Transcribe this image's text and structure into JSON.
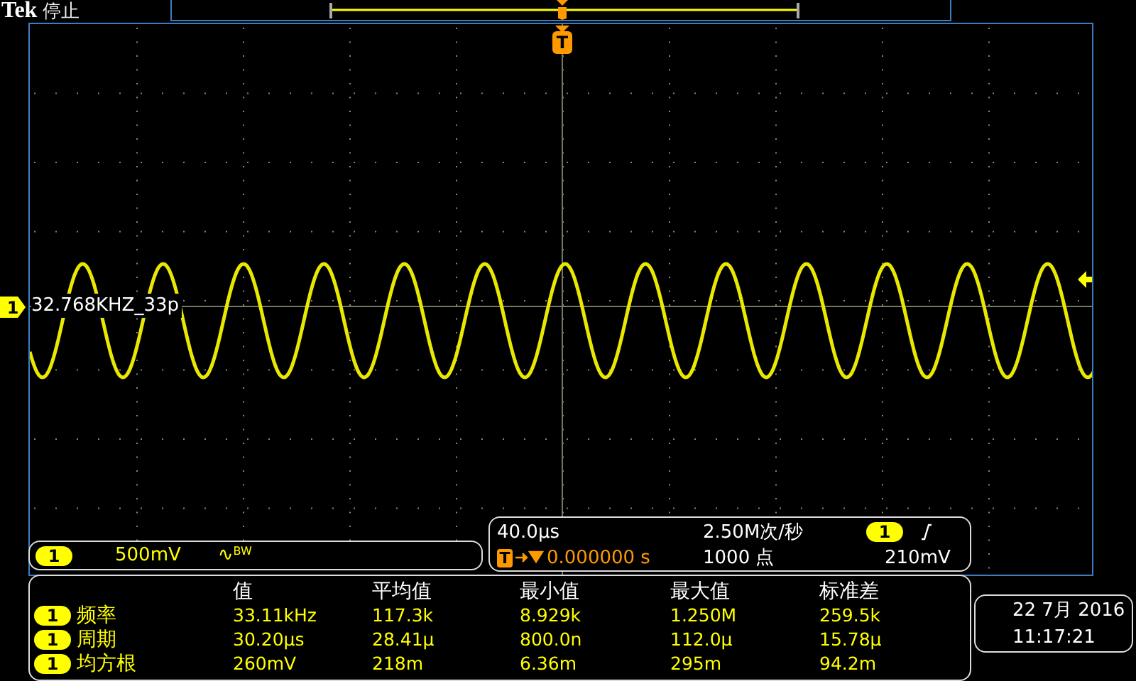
{
  "status": {
    "brand": "Tek",
    "state": "停止"
  },
  "trigger_marker": {
    "label": "T"
  },
  "channel": {
    "number": "1",
    "panel_number": "1",
    "label": "32.768KHZ_33p",
    "scale": "500mV",
    "bandwidth_symbol": "∿",
    "bandwidth_label": "BW"
  },
  "horizontal": {
    "scale": "40.0µs",
    "sample_rate": "2.50M次/秒",
    "record_length": "1000 点",
    "trigger_icon": "T",
    "trigger_delay": "0.000000 s"
  },
  "trigger": {
    "source": "1",
    "level": "210mV"
  },
  "measurements": {
    "columns": [
      "值",
      "平均值",
      "最小值",
      "最大值",
      "标准差"
    ],
    "rows": [
      {
        "channel": "1",
        "name": "频率",
        "values": [
          "33.11kHz",
          "117.3k",
          "8.929k",
          "1.250M",
          "259.5k"
        ]
      },
      {
        "channel": "1",
        "name": "周期",
        "values": [
          "30.20µs",
          "28.41µ",
          "800.0n",
          "112.0µ",
          "15.78µ"
        ]
      },
      {
        "channel": "1",
        "name": "均方根",
        "values": [
          "260mV",
          "218m",
          "6.36m",
          "295m",
          "94.2m"
        ]
      }
    ]
  },
  "datetime": {
    "date": "22 7月 2016",
    "time": "11:17:21"
  }
}
